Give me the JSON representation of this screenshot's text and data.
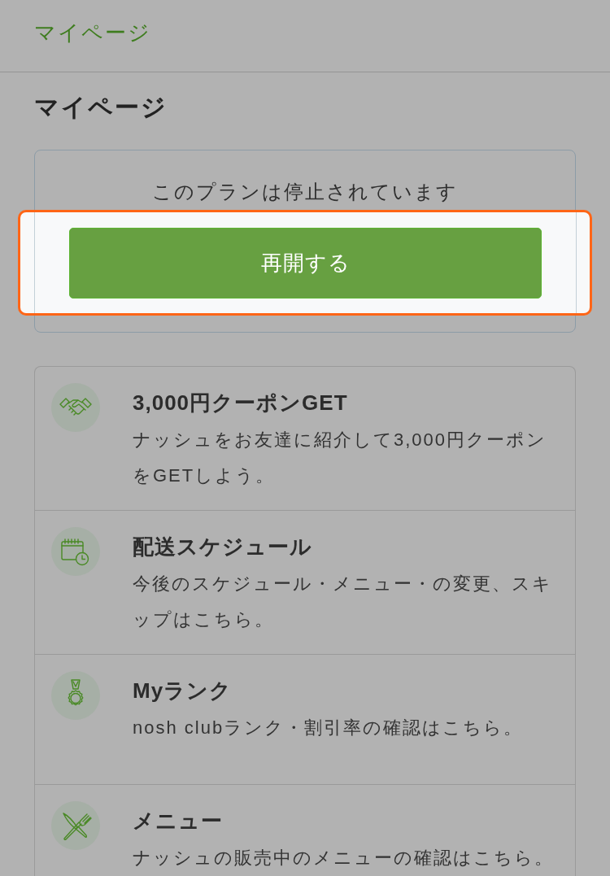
{
  "header": {
    "title": "マイページ"
  },
  "page_title": "マイページ",
  "plan_notice": {
    "message": "このプランは停止されています",
    "resume_button": {
      "label": "再開する",
      "highlighted": true
    }
  },
  "menu_items": [
    {
      "kind": "coupon",
      "title": "3,000円クーポンGET",
      "description": "ナッシュをお友達に紹介して3,000円クーポンをGETしよう。"
    },
    {
      "kind": "schedule",
      "title": "配送スケジュール",
      "description": "今後のスケジュール・メニュー・の変更、スキップはこちら。"
    },
    {
      "kind": "rank",
      "title": "Myランク",
      "description": "nosh clubランク・割引率の確認はこちら。"
    },
    {
      "kind": "menu",
      "title": "メニュー",
      "description": "ナッシュの販売中のメニューの確認はこちら。"
    }
  ]
}
